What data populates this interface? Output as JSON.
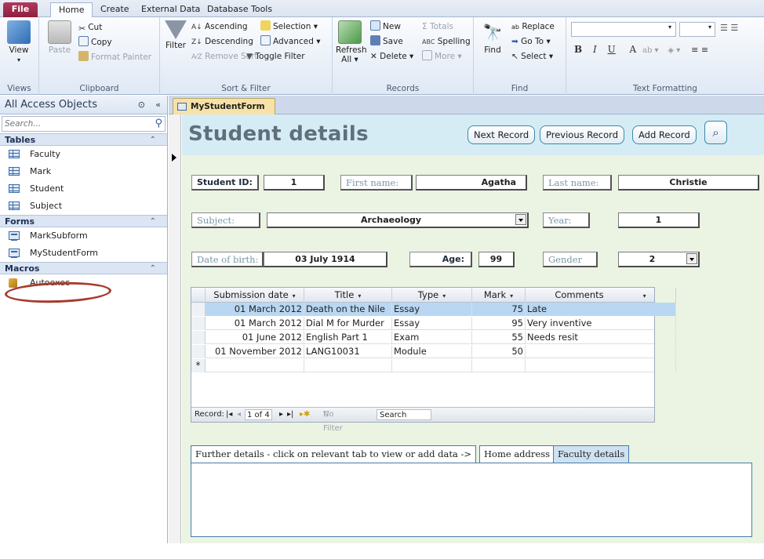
{
  "ribbon": {
    "tabs": [
      "File",
      "Home",
      "Create",
      "External Data",
      "Database Tools"
    ],
    "active_tab": "Home",
    "views": {
      "view_label": "View",
      "group_label": "Views"
    },
    "clipboard": {
      "paste": "Paste",
      "cut": "Cut",
      "copy": "Copy",
      "format_painter": "Format Painter",
      "group_label": "Clipboard"
    },
    "sort_filter": {
      "filter": "Filter",
      "ascending": "Ascending",
      "descending": "Descending",
      "remove_sort": "Remove Sort",
      "selection": "Selection",
      "advanced": "Advanced",
      "toggle_filter": "Toggle Filter",
      "group_label": "Sort & Filter"
    },
    "records": {
      "refresh": "Refresh",
      "refresh_sub": "All",
      "new": "New",
      "save": "Save",
      "delete": "Delete",
      "totals": "Totals",
      "spelling": "Spelling",
      "more": "More",
      "group_label": "Records"
    },
    "find": {
      "find": "Find",
      "replace": "Replace",
      "goto": "Go To",
      "select": "Select",
      "group_label": "Find"
    },
    "text_formatting": {
      "bold": "B",
      "italic": "I",
      "underline": "U",
      "font_color": "A",
      "group_label": "Text Formatting"
    }
  },
  "nav": {
    "title": "All Access Objects",
    "search_placeholder": "Search...",
    "sections": [
      {
        "name": "Tables",
        "items": [
          "Faculty",
          "Mark",
          "Student",
          "Subject"
        ]
      },
      {
        "name": "Forms",
        "items": [
          "MarkSubform",
          "MyStudentForm"
        ]
      },
      {
        "name": "Macros",
        "items": [
          "Autoexec"
        ]
      }
    ]
  },
  "document": {
    "tab_label": "MyStudentForm",
    "title": "Student details",
    "buttons": {
      "next": "Next Record",
      "previous": "Previous Record",
      "add": "Add Record"
    },
    "fields": {
      "student_id_label": "Student ID:",
      "student_id": "1",
      "first_name_label": "First name:",
      "first_name": "Agatha",
      "last_name_label": "Last name:",
      "last_name": "Christie",
      "subject_label": "Subject:",
      "subject": "Archaeology",
      "year_label": "Year:",
      "year": "1",
      "dob_label": "Date of birth:",
      "dob": "03 July 1914",
      "age_label": "Age:",
      "age": "99",
      "gender_label": "Gender",
      "gender": "2"
    },
    "subform": {
      "columns": [
        "Submission date",
        "Title",
        "Type",
        "Mark",
        "Comments"
      ],
      "rows": [
        [
          "01 March 2012",
          "Death on the Nile",
          "Essay",
          "75",
          "Late"
        ],
        [
          "01 March 2012",
          "Dial M for Murder",
          "Essay",
          "95",
          "Very inventive"
        ],
        [
          "01 June 2012",
          "English Part 1",
          "Exam",
          "55",
          "Needs resit"
        ],
        [
          "01 November 2012",
          "LANG10031",
          "Module",
          "50",
          ""
        ]
      ],
      "new_row_marker": "*",
      "nav": {
        "record_label": "Record:",
        "position": "1 of 4",
        "no_filter": "No Filter",
        "search": "Search"
      }
    },
    "tab_control": {
      "caption": "Further details - click on relevant tab to view or add data ->",
      "tabs": [
        "Home address",
        "Faculty details"
      ]
    }
  }
}
